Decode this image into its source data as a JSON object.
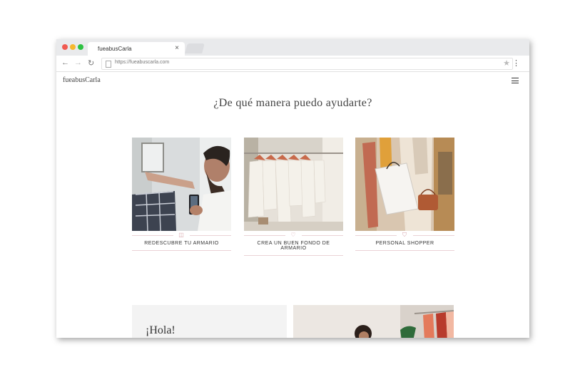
{
  "browser": {
    "tab_title": "fueabusCarla",
    "tab_close": "×",
    "url": "https://fueabuscarla.com",
    "back_icon": "←",
    "forward_icon": "→",
    "reload_icon": "↻",
    "star_icon": "★",
    "menu_icon": "⋮"
  },
  "site": {
    "logo": "fueabusCarla",
    "heading": "¿De qué manera puedo ayudarte?",
    "cards": [
      {
        "label": "REDESCUBRE TU ARMARIO",
        "icon": "camera-icon",
        "glyph": "◫"
      },
      {
        "label": "CREA UN BUEN FONDO DE ARMARIO",
        "icon": "heart-icon",
        "glyph": "♡"
      },
      {
        "label": "PERSONAL SHOPPER",
        "icon": "bag-icon",
        "glyph": "⛉"
      }
    ],
    "greeting": "¡Hola!"
  },
  "colors": {
    "accent_pink": "#d6a0a8",
    "divider": "#ead2d6",
    "text": "#333333"
  }
}
